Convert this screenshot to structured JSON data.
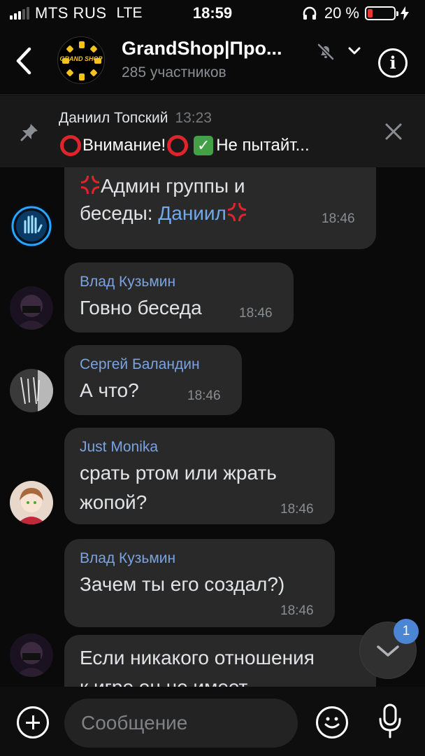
{
  "status_bar": {
    "carrier": "MTS RUS",
    "network": "LTE",
    "time": "18:59",
    "battery_text": "20 %",
    "battery_level": 0.2,
    "icons": [
      "signal-icon",
      "headphones-icon",
      "battery-icon",
      "charging-icon"
    ]
  },
  "header": {
    "title": "GrandShop|Про...",
    "subtitle": "285 участников",
    "avatar_logo": "GRAND SHOP",
    "icons": [
      "back-icon",
      "mute-icon",
      "chevron-down-icon",
      "info-icon"
    ]
  },
  "pinned": {
    "author": "Даниил Топский",
    "time": "13:23",
    "text_part1": "Внимание!",
    "text_part2": "Не пытайт..."
  },
  "messages": [
    {
      "author": "",
      "line1": "Админ группы и",
      "line2_prefix": "беседы: ",
      "line2_link": "Даниил",
      "time": "18:46"
    },
    {
      "author": "Влад Кузьмин",
      "text": "Говно беседа",
      "time": "18:46"
    },
    {
      "author": "Сергей Баландин",
      "text": "А что?",
      "time": "18:46"
    },
    {
      "author": "Just Monika",
      "line1": "срать ртом или жрать",
      "line2": "жопой?",
      "time": "18:46"
    },
    {
      "author": "Влад Кузьмин",
      "text": "Зачем ты его создал?)",
      "time": "18:46"
    },
    {
      "line1": "Если никакого отношения",
      "line2": "к игре он не имеет"
    }
  ],
  "scroll_badge": "1",
  "composer": {
    "placeholder": "Сообщение"
  },
  "colors": {
    "background": "#0a0a0a",
    "bubble": "#292929",
    "author_name": "#7aa3e0",
    "link": "#71aaeb",
    "badge": "#4a86d4",
    "battery_low": "#e53935"
  }
}
